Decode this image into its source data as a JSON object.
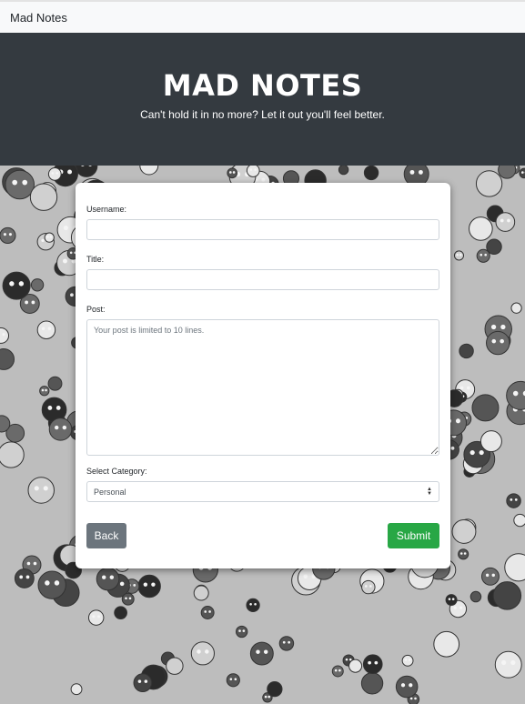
{
  "navbar": {
    "brand": "Mad Notes"
  },
  "hero": {
    "title": "MAD NOTES",
    "tagline": "Can't hold it in no more? Let it out you'll feel better."
  },
  "form": {
    "username_label": "Username:",
    "username_value": "",
    "title_label": "Title:",
    "title_value": "",
    "post_label": "Post:",
    "post_placeholder": "Your post is limited to 10 lines.",
    "post_value": "",
    "category_label": "Select Category:",
    "category_selected": "Personal",
    "back_label": "Back",
    "submit_label": "Submit"
  },
  "colors": {
    "hero_bg": "#343a40",
    "back_button": "#6c757d",
    "submit_button": "#28a745"
  }
}
